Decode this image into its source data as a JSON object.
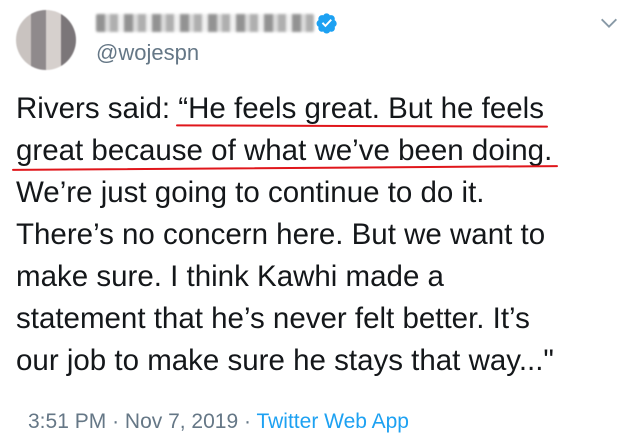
{
  "tweet": {
    "handle": "@wojespn",
    "lines": [
      {
        "pre": "Rivers said: ",
        "marked": "“He feels great. But he feels",
        "post": ""
      },
      {
        "pre": "",
        "marked": "great because of what we’ve been doing.",
        "post": ""
      },
      {
        "pre": "We’re just going to continue to do it.",
        "marked": "",
        "post": ""
      },
      {
        "pre": "There’s no concern here. But we want to",
        "marked": "",
        "post": ""
      },
      {
        "pre": "make sure. I think Kawhi made a",
        "marked": "",
        "post": ""
      },
      {
        "pre": "statement that he’s never felt better. It’s",
        "marked": "",
        "post": ""
      },
      {
        "pre": "our job to make sure he stays that way...\"",
        "marked": "",
        "post": ""
      }
    ],
    "time": "3:51 PM",
    "date": "Nov 7, 2019",
    "separator": "·",
    "source": "Twitter Web App"
  },
  "icons": {
    "verified": "verified-badge-icon",
    "chevron": "chevron-down-icon"
  },
  "colors": {
    "text": "#14171a",
    "secondary": "#657786",
    "link": "#1da1f2",
    "annotation": "#e0161b"
  }
}
